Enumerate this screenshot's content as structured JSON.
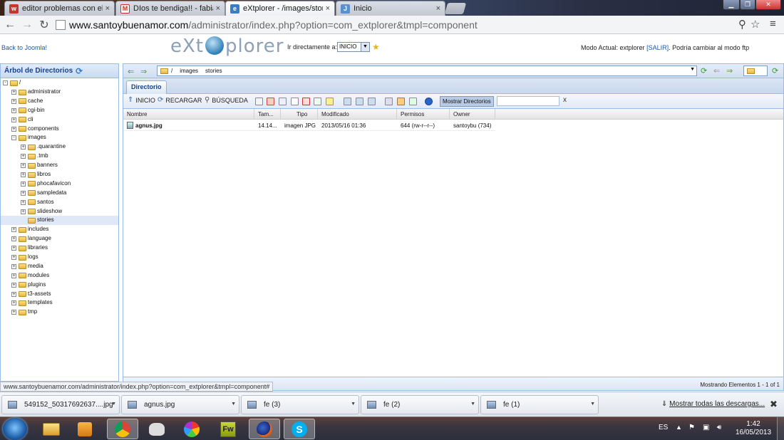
{
  "browser": {
    "tabs": [
      {
        "title": "editor problemas con el h",
        "favicon": "joomla-forum-icon",
        "color": "#c0392b"
      },
      {
        "title": "DIos te bendiga!! - fabiag",
        "favicon": "gmail-icon",
        "color": "#c23321"
      },
      {
        "title": "eXtplorer - /images/storie",
        "favicon": "extplorer-icon",
        "color": "#3b7dc4"
      },
      {
        "title": "Inicio",
        "favicon": "joomla-icon",
        "color": "#5a8fd0"
      }
    ],
    "close_glyph": "×",
    "url_host": "www.santoybuenamor.com",
    "url_path": "/administrator/index.php?option=com_extplorer&tmpl=component"
  },
  "header": {
    "back_link": "Back to Joomla!",
    "logo_left": "eXt",
    "logo_right": "plorer",
    "goto_label": "Ir directamente a:",
    "goto_value": "INICIO",
    "mode_text": "Modo Actual: extplorer",
    "logout_link": "[SALIR]",
    "mode_suffix": ". Podría cambiar al modo ftp"
  },
  "tree": {
    "title": "Árbol de Directorios",
    "root": "/",
    "items": [
      {
        "label": "administrator",
        "level": 1,
        "toggle": "+"
      },
      {
        "label": "cache",
        "level": 1,
        "toggle": "+"
      },
      {
        "label": "cgi-bin",
        "level": 1,
        "toggle": "+"
      },
      {
        "label": "cli",
        "level": 1,
        "toggle": "+"
      },
      {
        "label": "components",
        "level": 1,
        "toggle": "+"
      },
      {
        "label": "images",
        "level": 1,
        "toggle": "-"
      },
      {
        "label": ".quarantine",
        "level": 2,
        "toggle": "+"
      },
      {
        "label": ".tmb",
        "level": 2,
        "toggle": "+"
      },
      {
        "label": "banners",
        "level": 2,
        "toggle": "+"
      },
      {
        "label": "libros",
        "level": 2,
        "toggle": "+"
      },
      {
        "label": "phocafavicon",
        "level": 2,
        "toggle": "+"
      },
      {
        "label": "sampledata",
        "level": 2,
        "toggle": "+"
      },
      {
        "label": "santos",
        "level": 2,
        "toggle": "+"
      },
      {
        "label": "slideshow",
        "level": 2,
        "toggle": "+"
      },
      {
        "label": "stories",
        "level": 2,
        "toggle": "",
        "selected": true
      },
      {
        "label": "includes",
        "level": 1,
        "toggle": "+"
      },
      {
        "label": "language",
        "level": 1,
        "toggle": "+"
      },
      {
        "label": "libraries",
        "level": 1,
        "toggle": "+"
      },
      {
        "label": "logs",
        "level": 1,
        "toggle": "+"
      },
      {
        "label": "media",
        "level": 1,
        "toggle": "+"
      },
      {
        "label": "modules",
        "level": 1,
        "toggle": "+"
      },
      {
        "label": "plugins",
        "level": 1,
        "toggle": "+"
      },
      {
        "label": "t3-assets",
        "level": 1,
        "toggle": "+"
      },
      {
        "label": "templates",
        "level": 1,
        "toggle": "+"
      },
      {
        "label": "tmp",
        "level": 1,
        "toggle": "+"
      }
    ]
  },
  "pathbar": {
    "segments": [
      "/",
      "images",
      "stories"
    ]
  },
  "main": {
    "tab": "Directorio",
    "btn_home": "INICIO",
    "btn_reload": "RECARGAR",
    "btn_search": "BÚSQUEDA",
    "btn_show_dirs": "Mostrar Directorios",
    "filter_clear": "x",
    "columns": [
      "Nombre",
      "Tam...",
      "Tipo",
      "Modificado",
      "Permisos",
      "Owner"
    ],
    "rows": [
      {
        "name": "agnus.jpg",
        "size": "14.14...",
        "type": "imagen JPG",
        "modified": "2013/05/16 01:36",
        "perms": "644 (rw-r--r--)",
        "owner": "santoybu (734)"
      }
    ],
    "footer_count": "Mostrando Elementos 1 - 1 of 1"
  },
  "status_url": "www.santoybuenamor.com/administrator/index.php?option=com_extplorer&tmpl=component#",
  "downloads": {
    "items": [
      {
        "name": "549152_50317692637....jpg"
      },
      {
        "name": "agnus.jpg"
      },
      {
        "name": "fe (3)"
      },
      {
        "name": "fe (2)"
      },
      {
        "name": "fe (1)"
      }
    ],
    "show_all": "Mostrar todas las descargas...",
    "close": "✖"
  },
  "taskbar": {
    "apps": [
      "explorer-icon",
      "media-player-icon",
      "chrome-icon",
      "gimp-icon",
      "picasa-icon",
      "fireworks-icon",
      "firefox-icon",
      "skype-icon"
    ],
    "fw_label": "Fw",
    "skype_label": "S",
    "lang": "ES",
    "time": "1:42",
    "date": "16/05/2013"
  }
}
